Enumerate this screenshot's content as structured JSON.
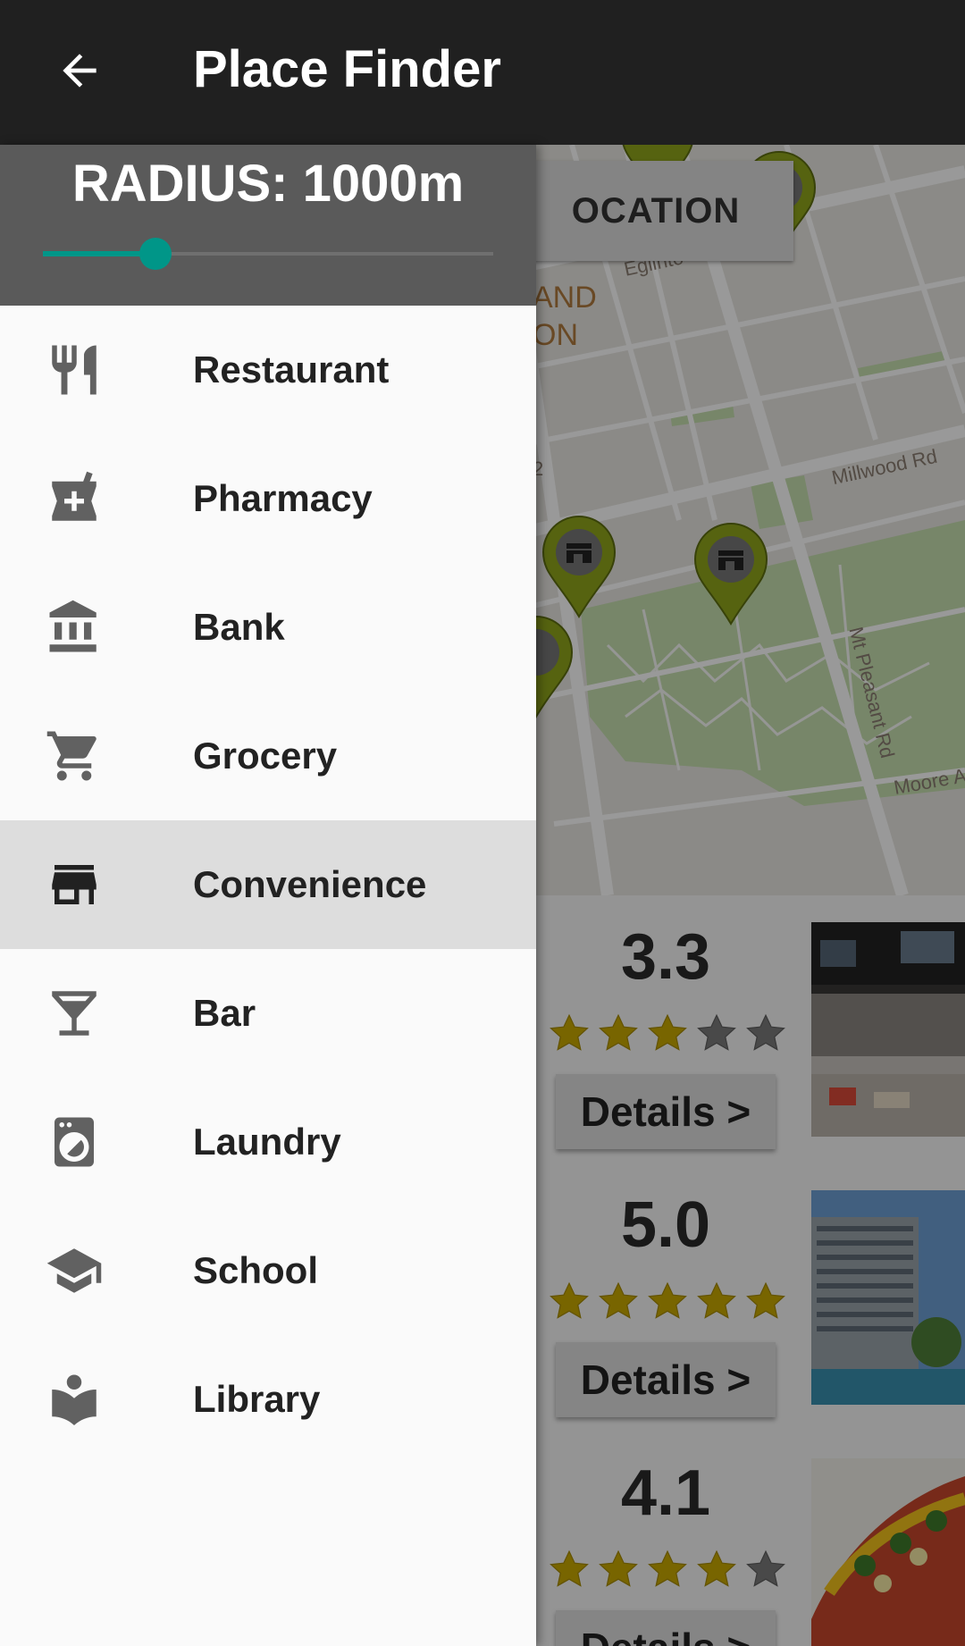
{
  "toolbar": {
    "title": "Place Finder",
    "back_icon": "arrow-back-icon",
    "background_color": "#202020"
  },
  "drawer": {
    "radius_label": "RADIUS: 1000m",
    "radius_slider_fraction": 0.25,
    "accent_color": "#009688",
    "selected_item": "Convenience",
    "items": [
      {
        "label": "Restaurant",
        "icon": "restaurant-icon"
      },
      {
        "label": "Pharmacy",
        "icon": "pharmacy-icon"
      },
      {
        "label": "Bank",
        "icon": "bank-icon"
      },
      {
        "label": "Grocery",
        "icon": "cart-icon"
      },
      {
        "label": "Convenience",
        "icon": "store-icon"
      },
      {
        "label": "Bar",
        "icon": "cocktail-icon"
      },
      {
        "label": "Laundry",
        "icon": "washing-machine-icon"
      },
      {
        "label": "School",
        "icon": "school-icon"
      },
      {
        "label": "Library",
        "icon": "library-icon"
      }
    ]
  },
  "map": {
    "location_button_label": "OCATION",
    "area_label": "AND\nON",
    "street_labels": [
      "Eglinto",
      "Millwood Rd",
      "Mt Pleasant Rd",
      "Moore A",
      "2"
    ],
    "marker_color": "#8fa51c"
  },
  "places": [
    {
      "rating": "3.3",
      "stars": 3.3,
      "details_label": "Details >"
    },
    {
      "rating": "5.0",
      "stars": 5.0,
      "details_label": "Details >"
    },
    {
      "rating": "4.1",
      "stars": 4.1,
      "details_label": "Details >"
    }
  ]
}
